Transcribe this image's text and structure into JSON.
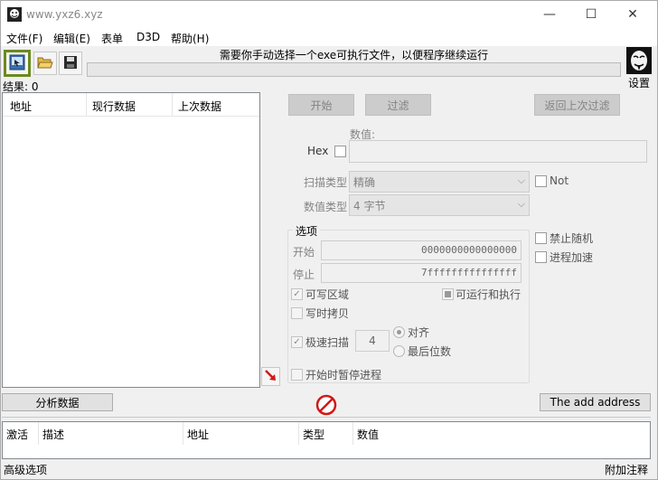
{
  "window": {
    "title": "www.yxz6.xyz",
    "minimize_glyph": "—",
    "maximize_glyph": "☐",
    "close_glyph": "✕"
  },
  "menu": {
    "items": [
      {
        "label": "文件(F)"
      },
      {
        "label": "编辑(E)"
      },
      {
        "label": "表单"
      },
      {
        "label": "D3D"
      },
      {
        "label": "帮助(H)"
      }
    ]
  },
  "toolbar": {
    "icons": [
      "process-select-icon",
      "open-file-icon",
      "save-icon"
    ],
    "progress_message": "需要你手动选择一个exe可执行文件，以便程序继续运行",
    "settings_label": "设置"
  },
  "results": {
    "label": "结果: 0",
    "columns": [
      "地址",
      "现行数据",
      "上次数据"
    ]
  },
  "scan": {
    "first_scan": "开始",
    "next_scan": "过滤",
    "undo_scan": "返回上次过滤",
    "value_label": "数值:",
    "hex_label": "Hex",
    "scan_type_label": "扫描类型",
    "scan_type_value": "精确",
    "value_type_label": "数值类型",
    "value_type_value": "4 字节",
    "not_label": "Not"
  },
  "options": {
    "group_label": "选项",
    "start_label": "开始",
    "start_value": "0000000000000000",
    "stop_label": "停止",
    "stop_value": "7fffffffffffffff",
    "writable": "可写区域",
    "executable": "可运行和执行",
    "copy_on_write": "写时拷贝",
    "fast_scan": "极速扫描",
    "fast_scan_value": "4",
    "alignment": "对齐",
    "last_digits": "最后位数",
    "pause_on_start": "开始时暂停进程",
    "disable_random": "禁止随机",
    "speedhack": "进程加速"
  },
  "bottom": {
    "analyze_button": "分析数据",
    "add_address_button": "The add address",
    "address_columns": [
      "激活",
      "描述",
      "地址",
      "类型",
      "数值"
    ],
    "advanced_options": "高级选项",
    "add_comment": "附加注释"
  },
  "colors": {
    "toolbar_highlight": "#6b8a1e",
    "disabled_text": "#838383",
    "cancel_red": "#d01919"
  }
}
